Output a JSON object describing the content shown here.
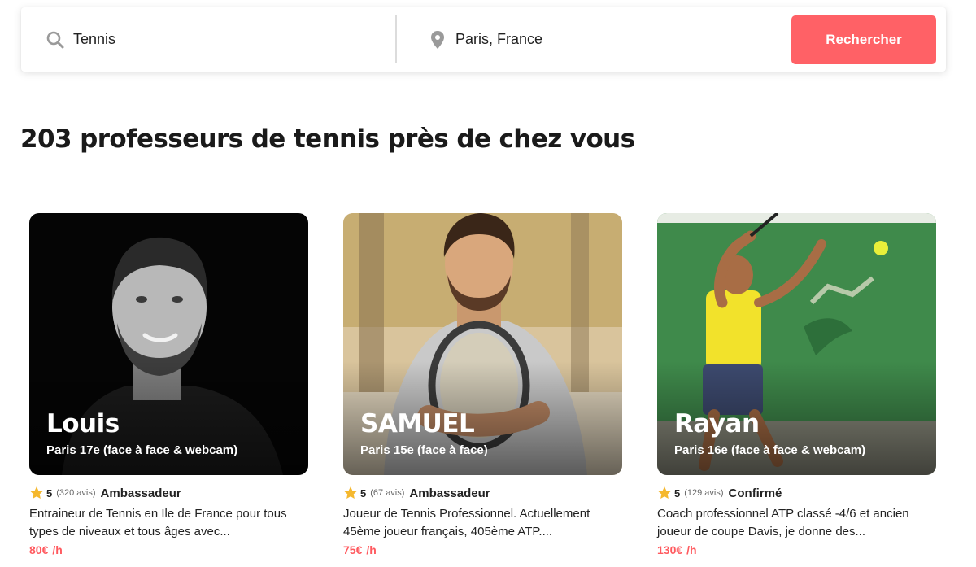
{
  "search": {
    "subject_value": "Tennis",
    "location_value": "Paris, France",
    "button_label": "Rechercher",
    "icons": {
      "subject": "search-icon",
      "location": "location-pin-icon"
    }
  },
  "results": {
    "title": "203 professeurs de tennis près de chez vous"
  },
  "colors": {
    "accent": "#ff6166",
    "price": "#ff5a5f",
    "star": "#f5b82e"
  },
  "teachers": [
    {
      "name": "Louis",
      "city": "Paris 17e (face à face & webcam)",
      "rating": "5",
      "reviews": "(320 avis)",
      "badge": "Ambassadeur",
      "description": "Entraineur de Tennis en Ile de France pour tous types de niveaux et tous âges avec...",
      "price": "80€",
      "unit": "/h"
    },
    {
      "name": "SAMUEL",
      "city": "Paris 15e (face à face)",
      "rating": "5",
      "reviews": "(67 avis)",
      "badge": "Ambassadeur",
      "description": "Joueur de Tennis Professionnel. Actuellement 45ème joueur français, 405ème ATP....",
      "price": "75€",
      "unit": "/h"
    },
    {
      "name": "Rayan",
      "city": "Paris 16e (face à face & webcam)",
      "rating": "5",
      "reviews": "(129 avis)",
      "badge": "Confirmé",
      "description": "Coach professionnel ATP classé -4/6 et ancien joueur de coupe Davis, je donne des...",
      "price": "130€",
      "unit": "/h"
    }
  ]
}
